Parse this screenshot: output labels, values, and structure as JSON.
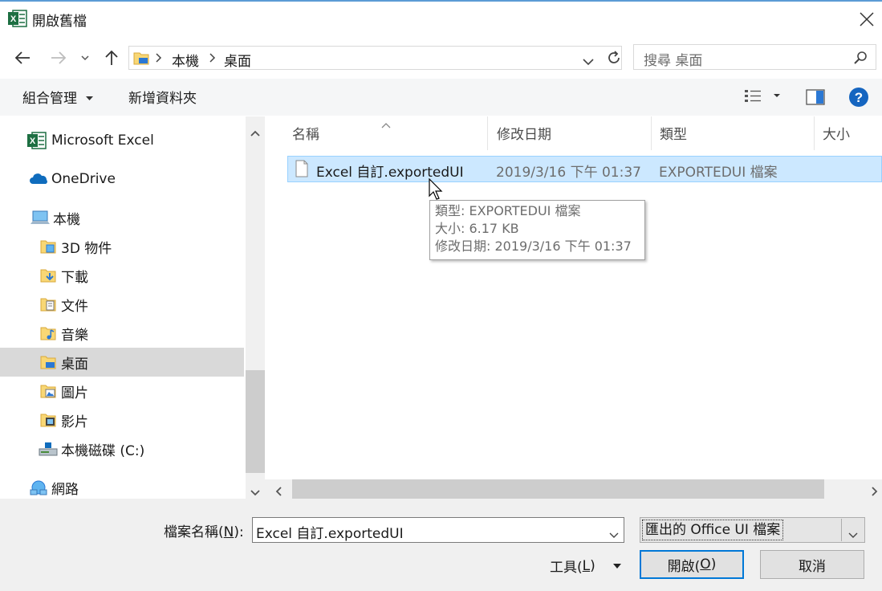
{
  "window": {
    "title": "開啟舊檔"
  },
  "address": {
    "seg1": "本機",
    "seg2": "桌面"
  },
  "search": {
    "placeholder": "搜尋 桌面"
  },
  "toolbar": {
    "organize": "組合管理",
    "new_folder": "新增資料夾"
  },
  "sidebar": {
    "items": [
      {
        "label": "Microsoft Excel",
        "icon": "excel-icon"
      },
      {
        "label": "OneDrive",
        "icon": "onedrive-icon"
      },
      {
        "label": "本機",
        "icon": "computer-icon"
      },
      {
        "label": "3D 物件",
        "icon": "3d-objects-folder-icon"
      },
      {
        "label": "下載",
        "icon": "downloads-folder-icon"
      },
      {
        "label": "文件",
        "icon": "documents-folder-icon"
      },
      {
        "label": "音樂",
        "icon": "music-folder-icon"
      },
      {
        "label": "桌面",
        "icon": "desktop-folder-icon"
      },
      {
        "label": "圖片",
        "icon": "pictures-folder-icon"
      },
      {
        "label": "影片",
        "icon": "videos-folder-icon"
      },
      {
        "label": "本機磁碟 (C:)",
        "icon": "drive-icon"
      },
      {
        "label": "網路",
        "icon": "network-icon"
      }
    ]
  },
  "columns": {
    "name": "名稱",
    "modified": "修改日期",
    "type": "類型",
    "size": "大小"
  },
  "files": [
    {
      "name": "Excel 自訂.exportedUI",
      "modified": "2019/3/16 下午 01:37",
      "type": "EXPORTEDUI 檔案"
    }
  ],
  "tooltip": {
    "line1": "類型: EXPORTEDUI 檔案",
    "line2": "大小: 6.17 KB",
    "line3": "修改日期: 2019/3/16 下午 01:37"
  },
  "footer": {
    "filename_label": "檔案名稱(",
    "filename_key": "N",
    "filename_label_end": "):",
    "filename_value": "Excel 自訂.exportedUI",
    "filetype_value": "匯出的 Office UI 檔案",
    "tools_label": "工具(",
    "tools_key": "L",
    "tools_end": ")",
    "open_label": "開啟(",
    "open_key": "O",
    "open_end": ")",
    "cancel_label": "取消"
  },
  "colors": {
    "accent": "#0078d7",
    "selection": "#cce8ff",
    "excel_green": "#1d6f42"
  }
}
